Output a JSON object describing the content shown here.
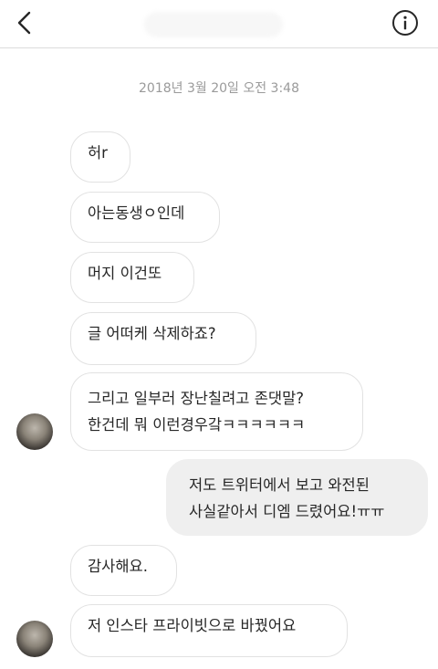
{
  "timestamp": "2018년 3월 20일 오전 3:48",
  "messages": [
    {
      "text": "허r"
    },
    {
      "text": "아는동생ㅇ인데"
    },
    {
      "text": "머지 이건또"
    },
    {
      "text": "글 어떠케 삭제하죠?"
    },
    {
      "line1": "그리고 일부러 장난칠려고 존댓말?",
      "line2": "한건데 뭐 이런경우갘ㅋㅋㅋㅋㅋㅋ"
    },
    {
      "line1": "저도 트위터에서 보고 와전된",
      "line2": "사실같아서 디엠 드렸어요!ㅠㅠ"
    },
    {
      "text": "감사해요."
    },
    {
      "text": "저 인스타 프라이빗으로 바꿨어요"
    }
  ],
  "colors": {
    "bubble_outgoing": "#efefef",
    "bubble_border": "#e2e2e2",
    "text": "#262626",
    "timestamp": "#9a9a9a"
  },
  "icons": {
    "back": "chevron-left-icon",
    "info": "info-icon"
  }
}
